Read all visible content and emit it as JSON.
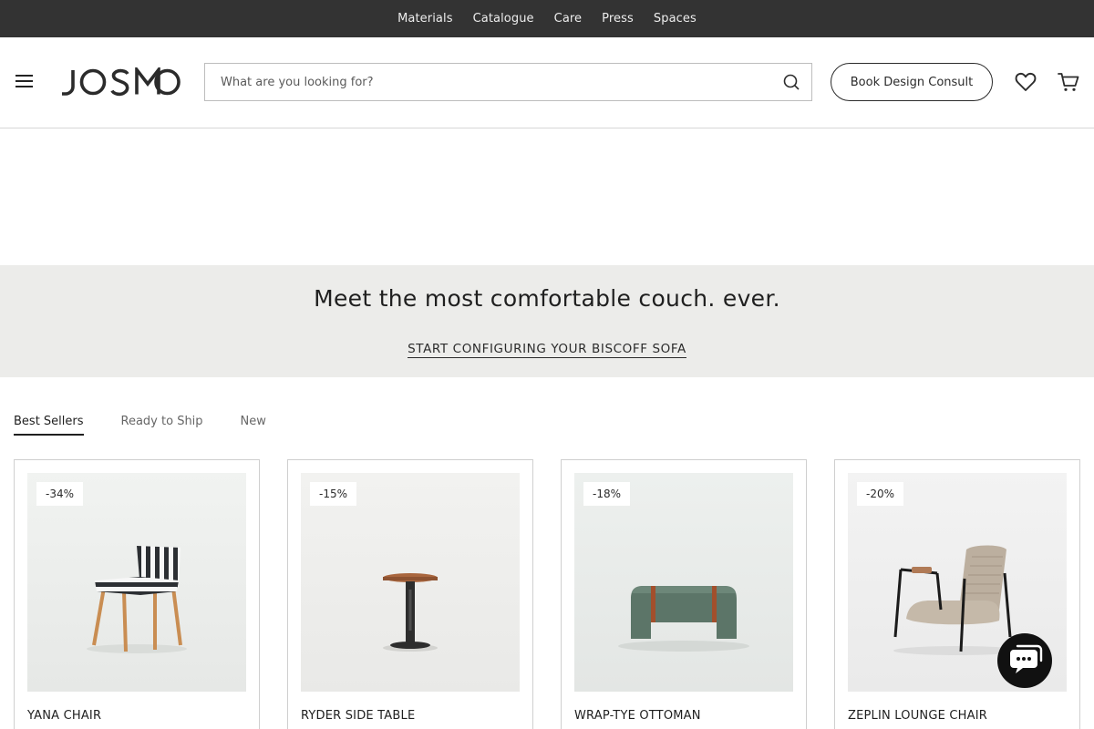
{
  "topnav": {
    "items": [
      "Materials",
      "Catalogue",
      "Care",
      "Press",
      "Spaces"
    ]
  },
  "header": {
    "logo_text": "JOSMO",
    "search": {
      "placeholder": "What are you looking for?",
      "value": ""
    },
    "consult_label": "Book Design Consult",
    "icons": [
      "menu-icon",
      "search-icon",
      "heart-icon",
      "cart-icon"
    ]
  },
  "promo": {
    "heading": "Meet the most comfortable couch. ever.",
    "link": "START CONFIGURING YOUR BISCOFF SOFA"
  },
  "tabs": [
    {
      "label": "Best Sellers",
      "active": true
    },
    {
      "label": "Ready to Ship",
      "active": false
    },
    {
      "label": "New",
      "active": false
    }
  ],
  "products": [
    {
      "name": "YANA CHAIR",
      "discount": "-34%"
    },
    {
      "name": "RYDER SIDE TABLE",
      "discount": "-15%"
    },
    {
      "name": "WRAP-TYE OTTOMAN",
      "discount": "-18%"
    },
    {
      "name": "ZEPLIN LOUNGE CHAIR",
      "discount": "-20%"
    }
  ],
  "colors": {
    "topbar": "#333333",
    "promo_bg": "#ececea",
    "text": "#2b2b2b"
  }
}
